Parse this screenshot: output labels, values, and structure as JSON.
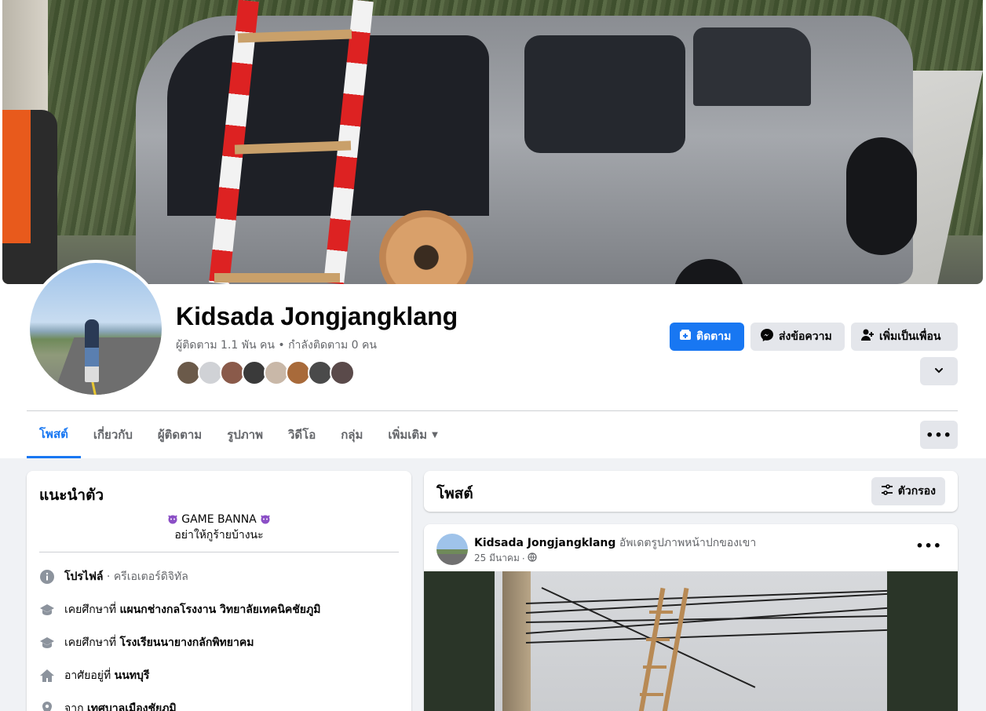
{
  "profile": {
    "name": "Kidsada Jongjangklang",
    "followers_text": "ผู้ติดตาม 1.1 พัน คน • กำลังติดตาม 0 คน",
    "friend_avatars": [
      "#6b5a4a",
      "#d0d2d6",
      "#8a5a4a",
      "#3a3a3a",
      "#c9b8a8",
      "#a86a3a",
      "#4a4a4a",
      "#5a4a4a"
    ]
  },
  "actions": {
    "follow_label": "ติดตาม",
    "message_label": "ส่งข้อความ",
    "add_friend_label": "เพิ่มเป็นเพื่อน"
  },
  "tabs": [
    {
      "label": "โพสต์",
      "active": true
    },
    {
      "label": "เกี่ยวกับ",
      "active": false
    },
    {
      "label": "ผู้ติดตาม",
      "active": false
    },
    {
      "label": "รูปภาพ",
      "active": false
    },
    {
      "label": "วิดีโอ",
      "active": false
    },
    {
      "label": "กลุ่ม",
      "active": false
    },
    {
      "label": "เพิ่มเติม",
      "active": false
    }
  ],
  "intro": {
    "title": "แนะนำตัว",
    "bio_line1": "GAME BANNA",
    "bio_line2": "อย่าให้กูร้ายบ้างนะ",
    "rows": [
      {
        "icon": "info-icon",
        "bold": "โปรไฟล์",
        "muted": " · ครีเอเตอร์ดิจิทัล",
        "prefix": ""
      },
      {
        "icon": "graduation-cap-icon",
        "prefix": "เคยศึกษาที่ ",
        "bold": "แผนกช่างกลโรงงาน วิทยาลัยเทคนิคชัยภูมิ",
        "muted": ""
      },
      {
        "icon": "graduation-cap-icon",
        "prefix": "เคยศึกษาที่ ",
        "bold": "โรงเรียนนายางกลักพิทยาคม",
        "muted": ""
      },
      {
        "icon": "home-icon",
        "prefix": "อาศัยอยู่ที่ ",
        "bold": "นนทบุรี",
        "muted": ""
      },
      {
        "icon": "location-pin-icon",
        "prefix": "จาก ",
        "bold": "เทศบาลเมืองชัยภูมิ",
        "muted": ""
      }
    ]
  },
  "posts_header": {
    "title": "โพสต์",
    "filter_label": "ตัวกรอง"
  },
  "post": {
    "author": "Kidsada Jongjangklang",
    "activity": " อัพเดตรูปภาพหน้าปกของเขา",
    "date": "25 มีนาคม",
    "privacy_icon": "globe-icon"
  },
  "colors": {
    "accent": "#1877f2",
    "secondary_button": "#e4e6eb",
    "page_bg": "#f0f2f5"
  }
}
